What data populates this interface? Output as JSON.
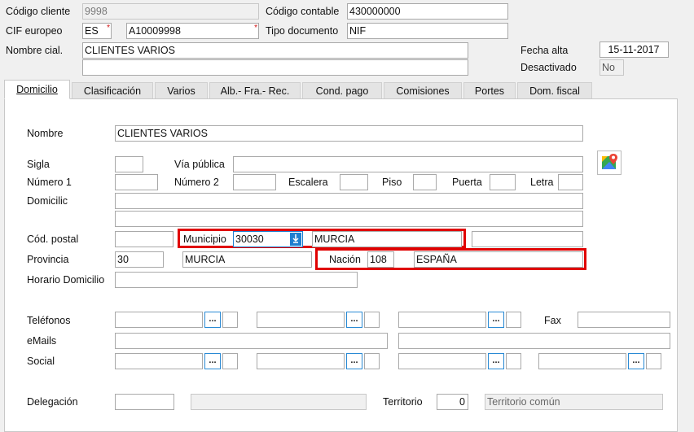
{
  "header": {
    "codigo_cliente": {
      "label": "Código cliente",
      "value": "9998"
    },
    "codigo_contable": {
      "label": "Código contable",
      "value": "430000000"
    },
    "cif_europeo": {
      "label": "CIF europeo",
      "country": "ES",
      "value": "A10009998"
    },
    "tipo_documento": {
      "label": "Tipo documento",
      "value": "NIF"
    },
    "nombre_cial": {
      "label": "Nombre cial.",
      "value": "CLIENTES VARIOS",
      "value2": ""
    },
    "fecha_alta": {
      "label": "Fecha alta",
      "value": "15-11-2017"
    },
    "desactivado": {
      "label": "Desactivado",
      "value": "No"
    }
  },
  "tabs": [
    {
      "label": "Domicilio",
      "active": true
    },
    {
      "label": "Clasificación"
    },
    {
      "label": "Varios"
    },
    {
      "label": "Alb.- Fra.- Rec."
    },
    {
      "label": "Cond. pago"
    },
    {
      "label": "Comisiones"
    },
    {
      "label": "Portes"
    },
    {
      "label": "Dom. fiscal"
    }
  ],
  "domicilio": {
    "nombre": {
      "label": "Nombre",
      "value": "CLIENTES VARIOS"
    },
    "sigla": {
      "label": "Sigla",
      "value": ""
    },
    "via_publica": {
      "label": "Vía pública",
      "value": ""
    },
    "numero1": {
      "label": "Número 1",
      "value": ""
    },
    "numero2": {
      "label": "Número 2",
      "value": ""
    },
    "escalera": {
      "label": "Escalera",
      "value": ""
    },
    "piso": {
      "label": "Piso",
      "value": ""
    },
    "puerta": {
      "label": "Puerta",
      "value": ""
    },
    "letra": {
      "label": "Letra",
      "value": ""
    },
    "domicilio": {
      "label": "Domicilic",
      "value": "",
      "value2": ""
    },
    "cod_postal": {
      "label": "Cód. postal",
      "value": "",
      "extra": ""
    },
    "municipio": {
      "label": "Municipio",
      "code": "30030",
      "name": "MURCIA"
    },
    "provincia": {
      "label": "Provincia",
      "code": "30",
      "name": "MURCIA"
    },
    "nacion": {
      "label": "Nación",
      "code": "108",
      "name": "ESPAÑA"
    },
    "horario": {
      "label": "Horario Domicilio",
      "value": ""
    },
    "telefonos": {
      "label": "Teléfonos"
    },
    "fax": {
      "label": "Fax",
      "value": ""
    },
    "emails": {
      "label": "eMails"
    },
    "social": {
      "label": "Social"
    },
    "delegacion": {
      "label": "Delegación",
      "value": ""
    },
    "territorio": {
      "label": "Territorio",
      "code": "0",
      "name": "Territorio común"
    },
    "dots": "..."
  },
  "icons": {
    "map": "map-pin-icon",
    "dropdown": "arrow-down-icon"
  },
  "colors": {
    "highlight": "#e00000",
    "accent": "#1e7fd0"
  }
}
